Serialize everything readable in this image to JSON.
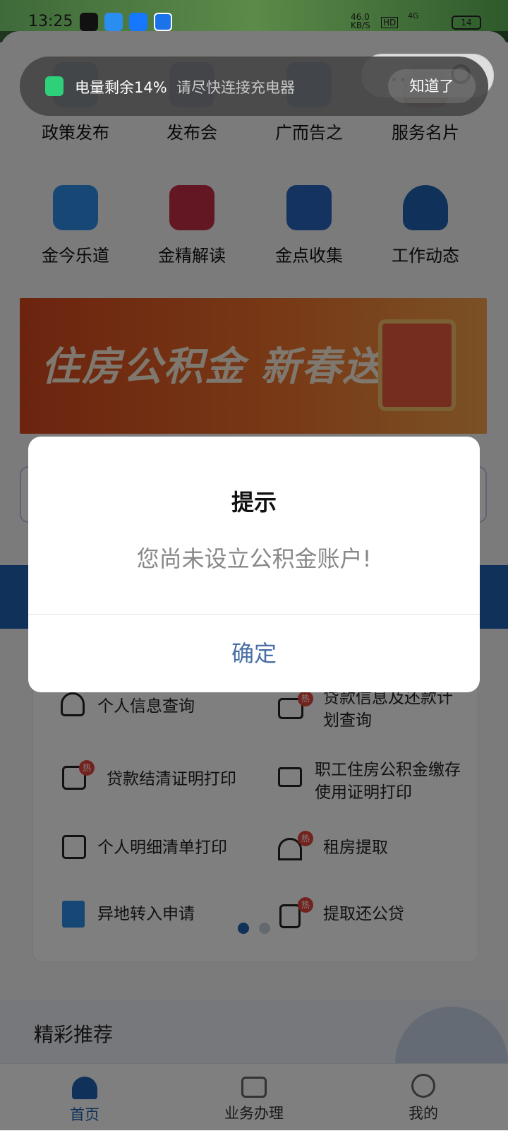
{
  "status_bar": {
    "time": "13:25",
    "net_speed": "46.0",
    "net_unit": "KB/S",
    "hd": "HD",
    "signal": "4G",
    "battery": "14"
  },
  "toast": {
    "battery_text": "电量剩余14%",
    "hint": "请尽快连接充电器",
    "action": "知道了"
  },
  "grid_row1": [
    "政策发布",
    "发布会",
    "广而告之",
    "服务名片"
  ],
  "grid_row2": [
    "金今乐道",
    "金精解读",
    "金点收集",
    "工作动态"
  ],
  "banner": {
    "text": "住房公积金 新春送礼"
  },
  "dialog": {
    "title": "提示",
    "message": "您尚未设立公积金账户!",
    "confirm": "确定"
  },
  "services": {
    "left": [
      "个人信息查询",
      "贷款结清证明打印",
      "个人明细清单打印",
      "异地转入申请"
    ],
    "right": [
      "贷款信息及还款计划查询",
      "职工住房公积金缴存使用证明打印",
      "租房提取",
      "提取还公贷"
    ],
    "hot_label": "热"
  },
  "recommend": {
    "title": "精彩推荐"
  },
  "tabbar": {
    "home": "首页",
    "business": "业务办理",
    "mine": "我的"
  },
  "colors": {
    "primary": "#1f63b5",
    "dialog_button": "#4a6fa5",
    "hot": "#e6463c"
  }
}
